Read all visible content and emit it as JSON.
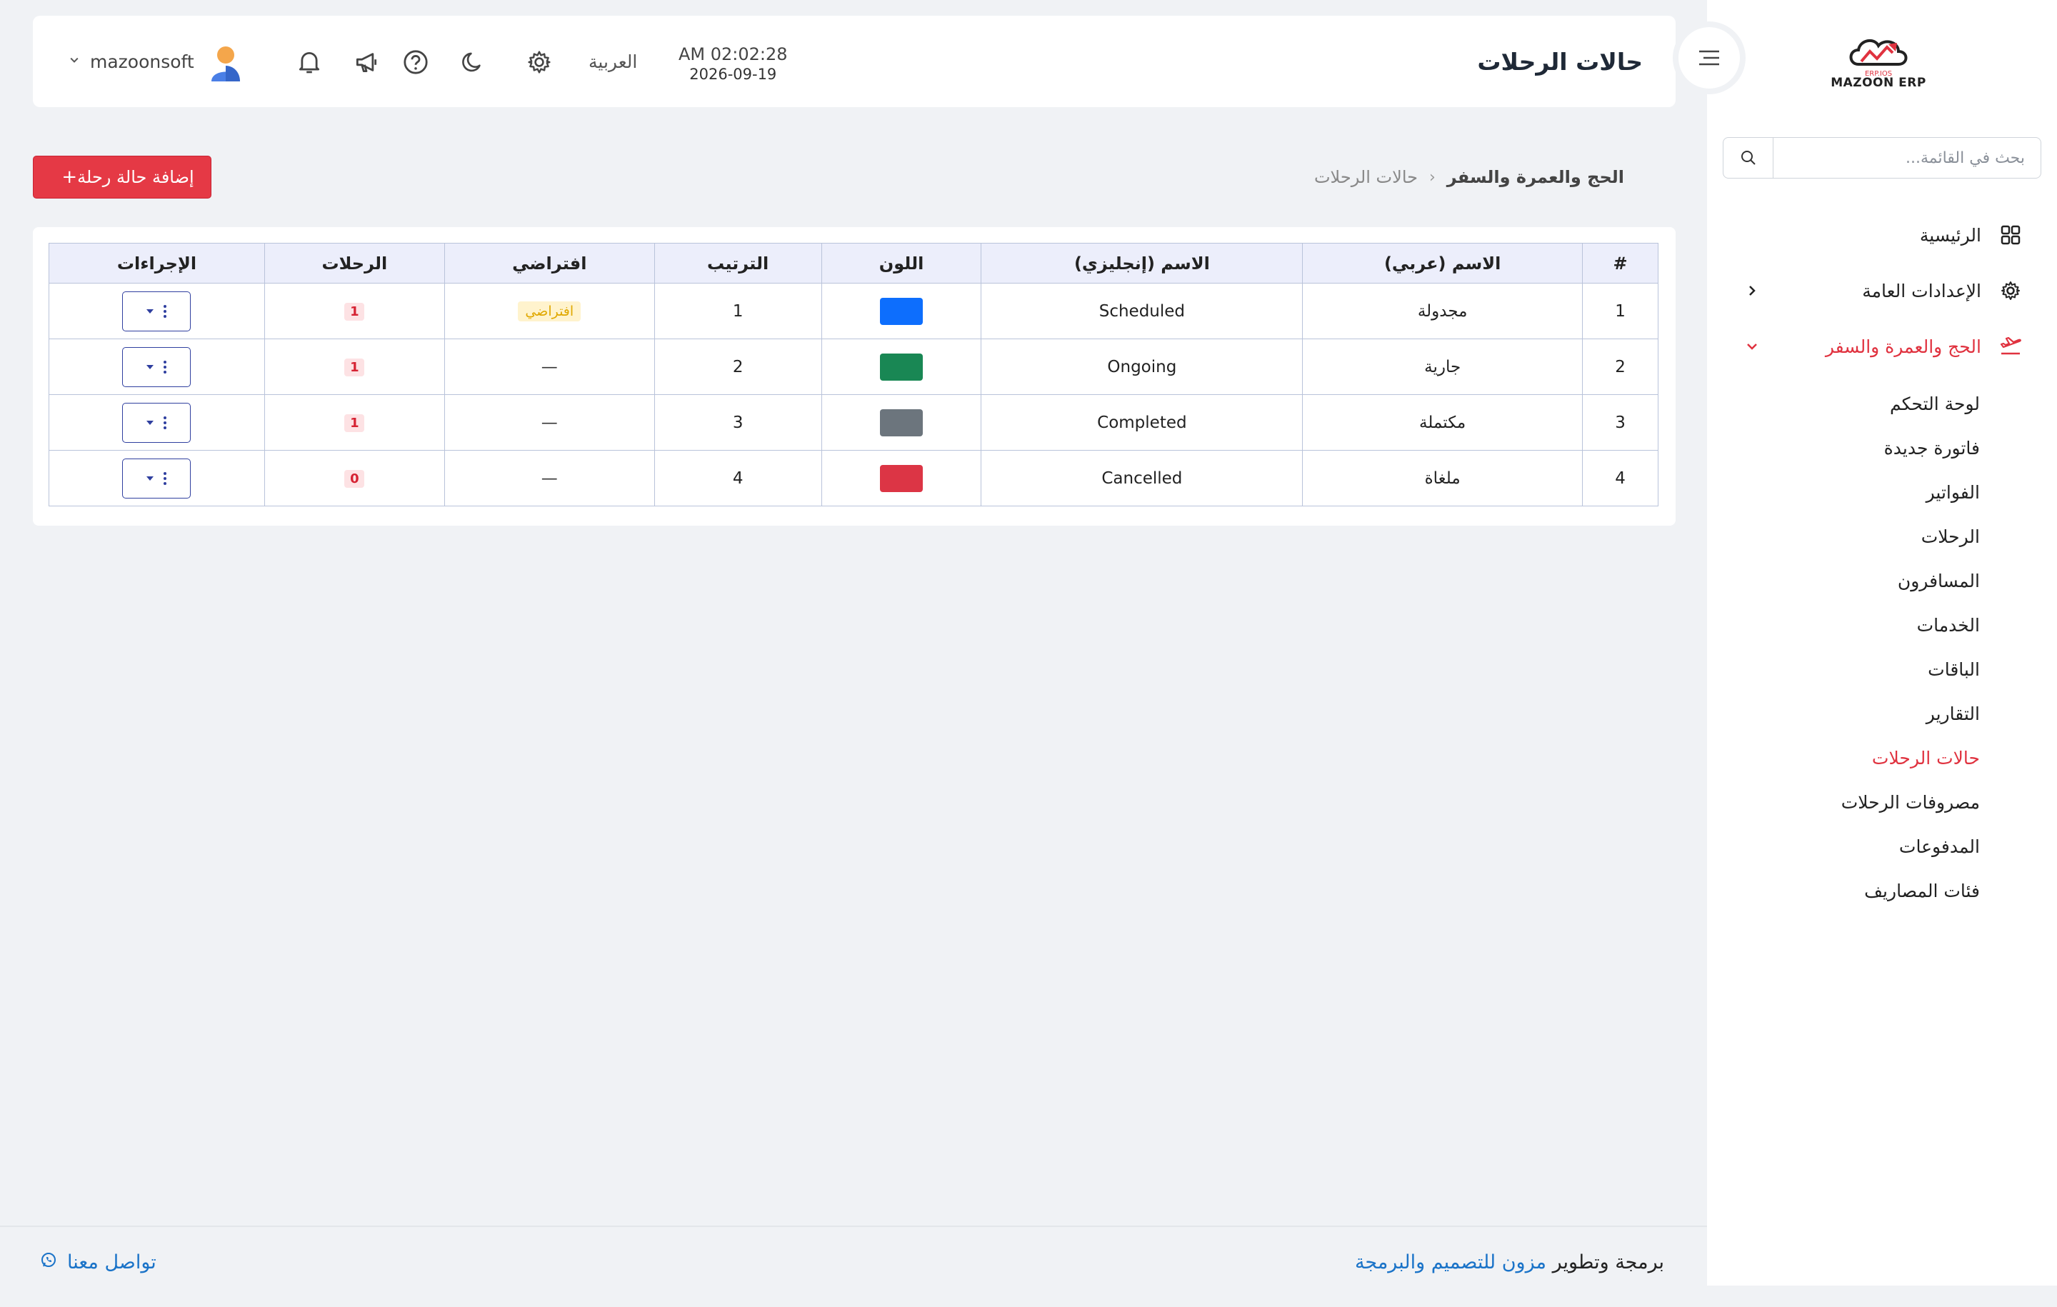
{
  "brand": {
    "logo_text": "MAZOON ERP",
    "logo_small": "ERP.IOS"
  },
  "sidebar": {
    "search_placeholder": "بحث في القائمة...",
    "items": [
      {
        "label": "الرئيسية",
        "icon": "grid-icon"
      },
      {
        "label": "الإعدادات العامة",
        "icon": "gear-icon"
      },
      {
        "label": "الحج والعمرة والسفر",
        "icon": "plane-icon"
      }
    ],
    "sub_items": [
      "لوحة التحكم",
      "فاتورة جديدة",
      "الفواتير",
      "الرحلات",
      "المسافرون",
      "الخدمات",
      "الباقات",
      "التقارير",
      "حالات الرحلات",
      "مصروفات الرحلات",
      "المدفوعات",
      "فئات المصاريف"
    ]
  },
  "header": {
    "title": "حالات الرحلات",
    "time": "AM 02:02:28",
    "date": "2026-09-19",
    "language": "العربية",
    "username": "mazoonsoft"
  },
  "breadcrumb": {
    "parent": "الحج والعمرة والسفر",
    "separator": "‹",
    "current": "حالات الرحلات"
  },
  "add_button": {
    "label": "إضافة حالة رحلة",
    "icon": "+"
  },
  "table": {
    "headers": [
      "#",
      "الاسم (عربي)",
      "الاسم (إنجليزي)",
      "اللون",
      "الترتيب",
      "افتراضي",
      "الرحلات",
      "الإجراءات"
    ],
    "default_badge": "افتراضي",
    "rows": [
      {
        "num": "1",
        "name_ar": "مجدولة",
        "name_en": "Scheduled",
        "color": "#0d6efd",
        "order": "1",
        "default": "افتراضي",
        "trips": "1"
      },
      {
        "num": "2",
        "name_ar": "جارية",
        "name_en": "Ongoing",
        "color": "#198754",
        "order": "2",
        "default": "—",
        "trips": "1"
      },
      {
        "num": "3",
        "name_ar": "مكتملة",
        "name_en": "Completed",
        "color": "#6c757d",
        "order": "3",
        "default": "—",
        "trips": "1"
      },
      {
        "num": "4",
        "name_ar": "ملغاة",
        "name_en": "Cancelled",
        "color": "#dc3545",
        "order": "4",
        "default": "—",
        "trips": "0"
      }
    ]
  },
  "footer": {
    "credit_prefix": "برمجة وتطوير",
    "credit_link": "مزون للتصميم والبرمجة",
    "contact": "تواصل معنا"
  },
  "colors": {
    "accent": "#e53945",
    "link": "#1a73c8",
    "header_bg": "#eceefb"
  }
}
